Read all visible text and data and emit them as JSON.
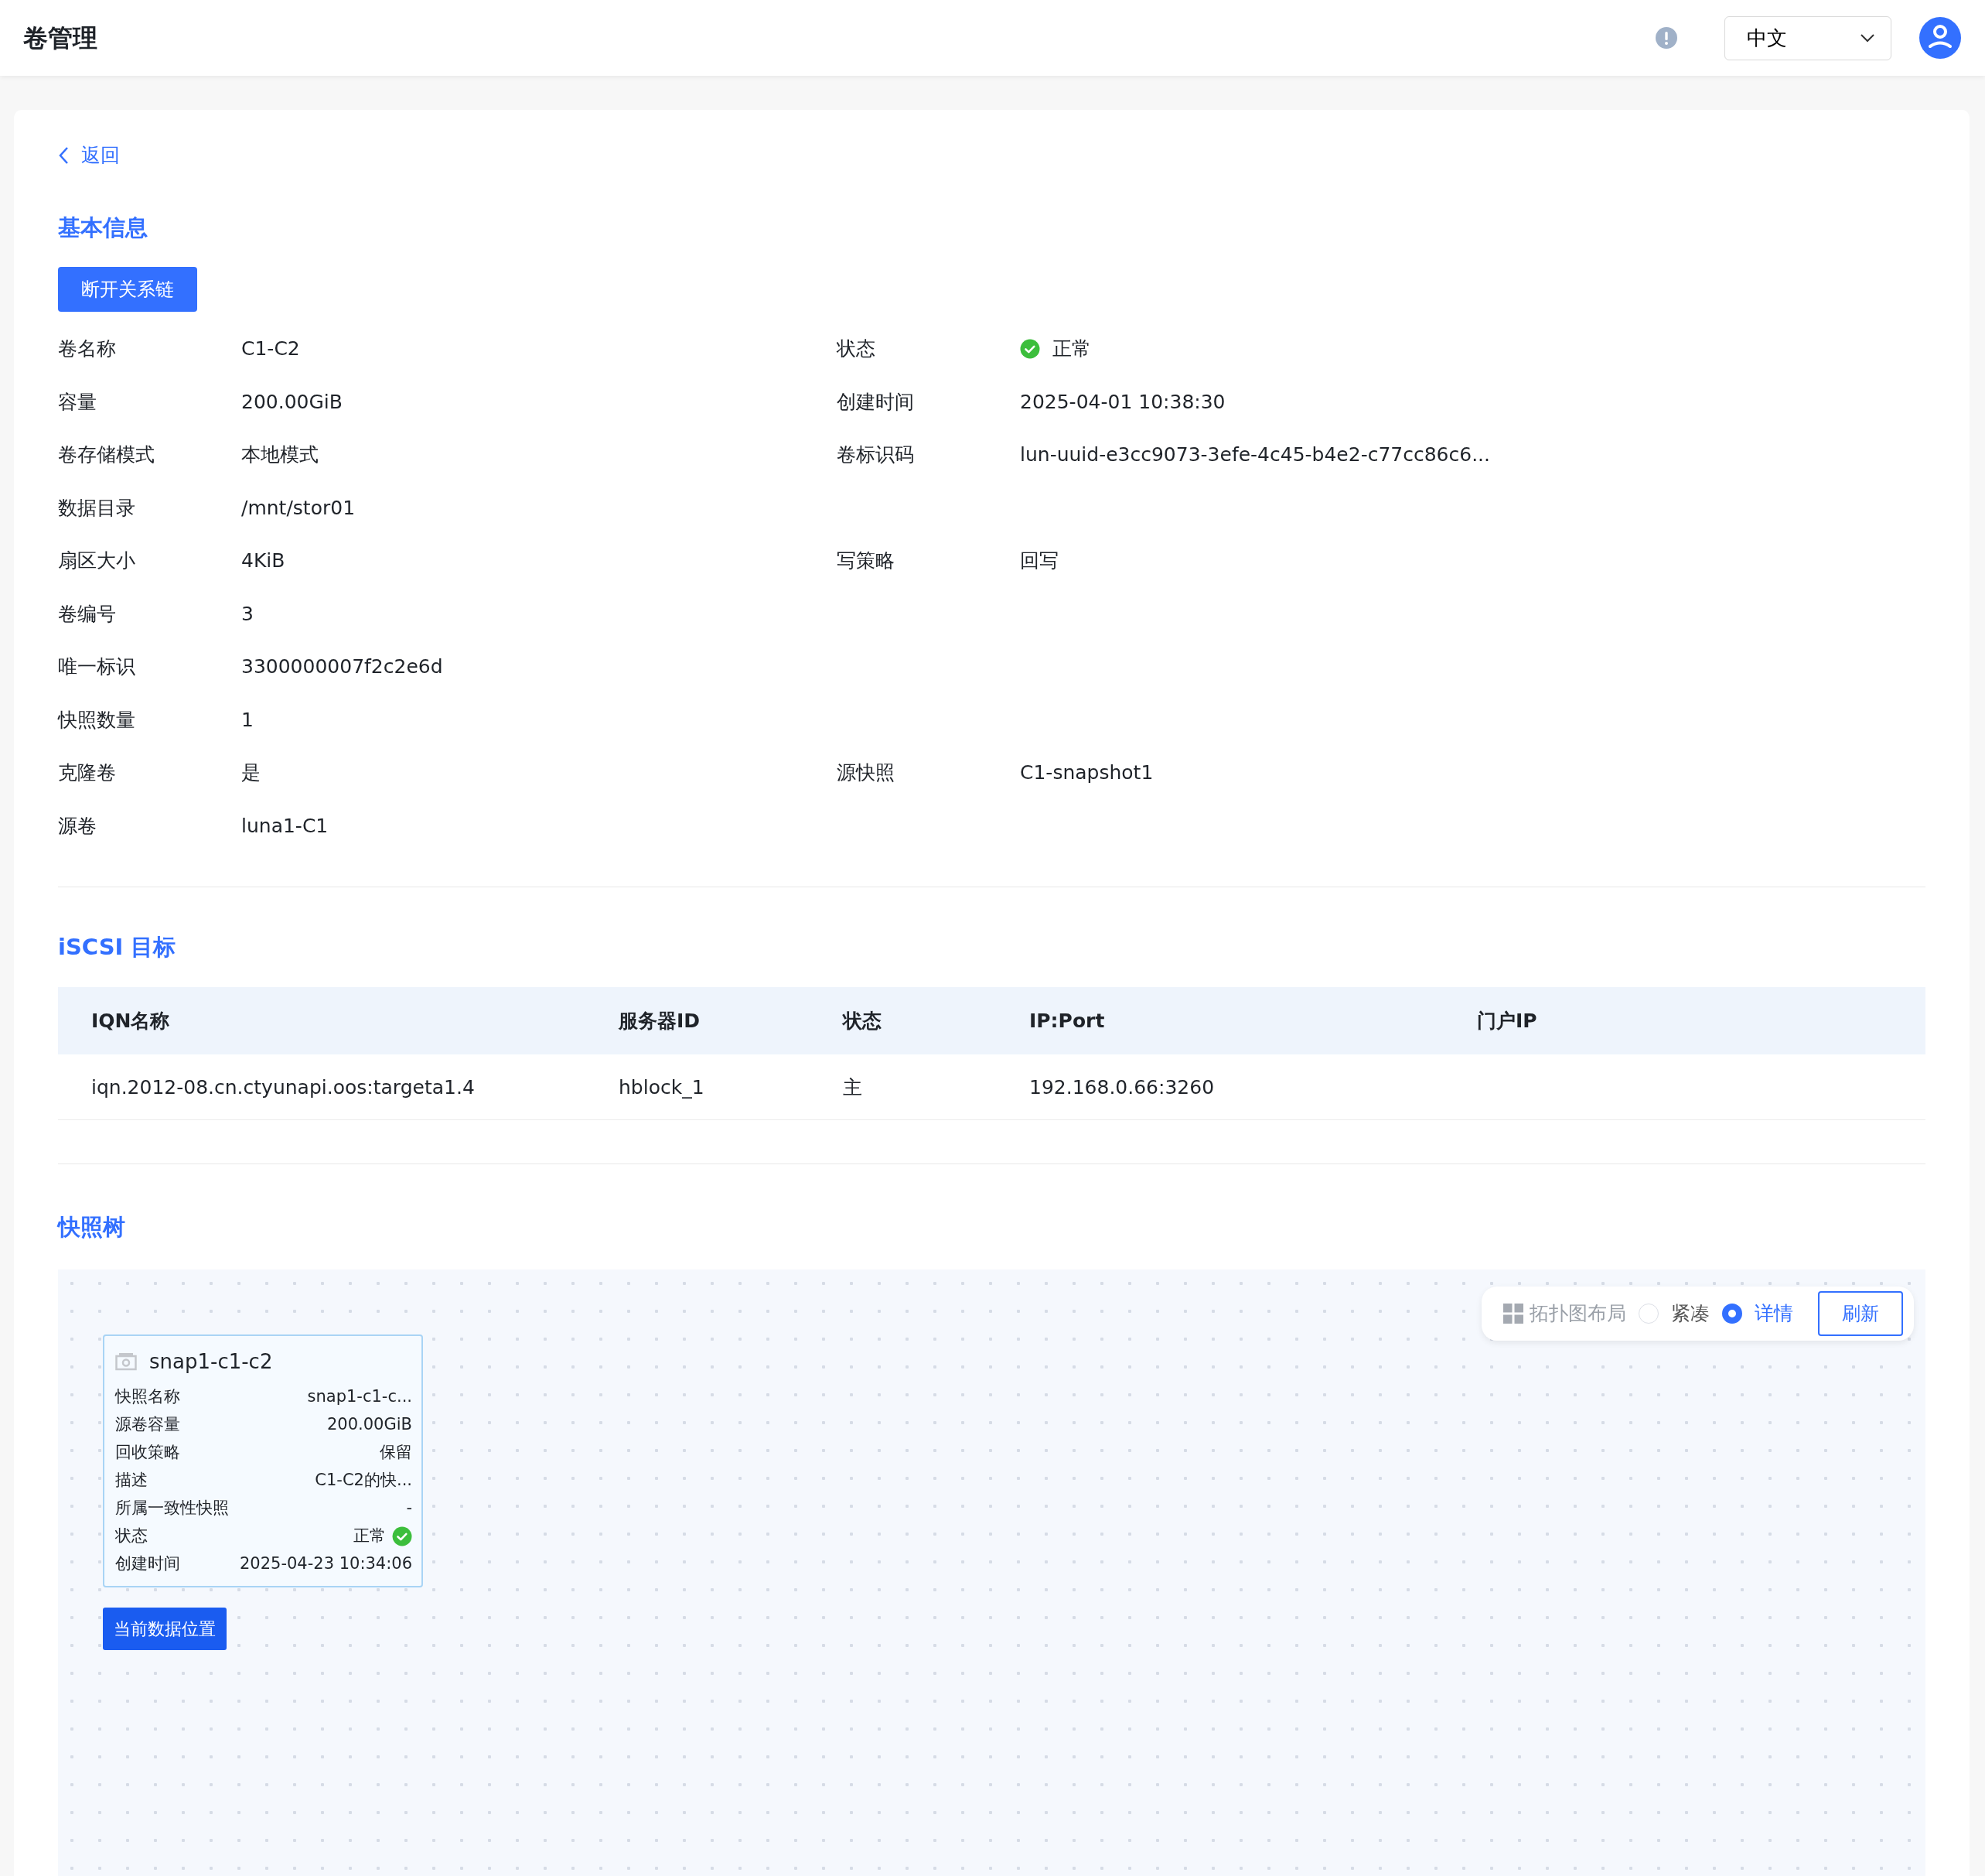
{
  "header": {
    "title": "卷管理",
    "language": "中文"
  },
  "back": "返回",
  "basic_info": {
    "title": "基本信息",
    "action": "断开关系链",
    "rows": [
      [
        {
          "label": "卷名称",
          "value": "C1-C2"
        },
        {
          "label": "状态",
          "value": "正常",
          "kind": "status"
        }
      ],
      [
        {
          "label": "容量",
          "value": "200.00GiB"
        },
        {
          "label": "创建时间",
          "value": "2025-04-01 10:38:30"
        }
      ],
      [
        {
          "label": "卷存储模式",
          "value": "本地模式"
        },
        {
          "label": "卷标识码",
          "value": "lun-uuid-e3cc9073-3efe-4c45-b4e2-c77cc86c6..."
        }
      ],
      [
        {
          "label": "数据目录",
          "value": "/mnt/stor01"
        }
      ],
      [
        {
          "label": "扇区大小",
          "value": "4KiB"
        },
        {
          "label": "写策略",
          "value": "回写"
        }
      ],
      [
        {
          "label": "卷编号",
          "value": "3"
        }
      ],
      [
        {
          "label": "唯一标识",
          "value": "3300000007f2c2e6d"
        }
      ],
      [
        {
          "label": "快照数量",
          "value": "1"
        }
      ],
      [
        {
          "label": "克隆卷",
          "value": "是"
        },
        {
          "label": "源快照",
          "value": "C1-snapshot1"
        }
      ],
      [
        {
          "label": "源卷",
          "value": "luna1-C1"
        }
      ]
    ]
  },
  "iscsi": {
    "title": "iSCSI 目标",
    "columns": [
      "IQN名称",
      "服务器ID",
      "状态",
      "IP:Port",
      "门户IP"
    ],
    "rows": [
      [
        "iqn.2012-08.cn.ctyunapi.oos:targeta1.4",
        "hblock_1",
        "主",
        "192.168.0.66:3260"
      ]
    ]
  },
  "snapshot_tree": {
    "title": "快照树",
    "toolbar": {
      "label": "拓扑图布局",
      "options": [
        {
          "label": "紧凑",
          "selected": false
        },
        {
          "label": "详情",
          "selected": true
        }
      ],
      "refresh": "刷新"
    },
    "node": {
      "title": "snap1-c1-c2",
      "fields": [
        {
          "label": "快照名称",
          "value": "snap1-c1-c..."
        },
        {
          "label": "源卷容量",
          "value": "200.00GiB"
        },
        {
          "label": "回收策略",
          "value": "保留"
        },
        {
          "label": "描述",
          "value": "C1-C2的快..."
        },
        {
          "label": "所属一致性快照",
          "value": "-"
        },
        {
          "label": "状态",
          "value": "正常",
          "kind": "status"
        },
        {
          "label": "创建时间",
          "value": "2025-04-23 10:34:06"
        }
      ]
    },
    "current": "当前数据位置"
  }
}
